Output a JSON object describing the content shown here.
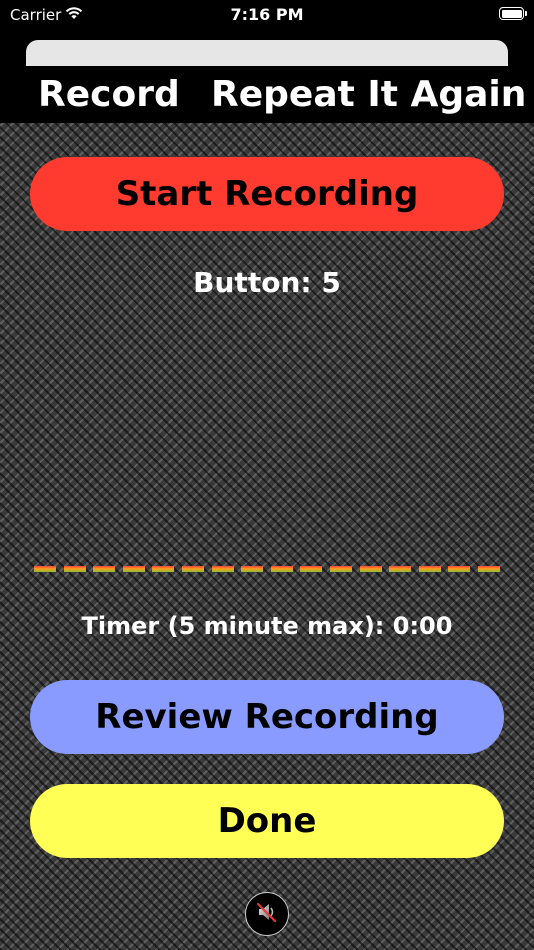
{
  "status_bar": {
    "carrier": "Carrier",
    "time": "7:16 PM",
    "icons": [
      "wifi-icon",
      "battery-icon"
    ]
  },
  "title_bar": {
    "record_label": "Record",
    "repeat_label": "Repeat It Again"
  },
  "controls": {
    "start_label": "Start Recording",
    "button_count_text": "Button: 5",
    "timer_text": "Timer (5 minute max): 0:00",
    "review_label": "Review Recording",
    "done_label": "Done",
    "speaker_icon": "speaker-muted-icon"
  },
  "colors": {
    "start_button": "#ff3b30",
    "review_button": "#8a9bff",
    "done_button": "#ffff55",
    "title_bar_bg": "#000000"
  }
}
